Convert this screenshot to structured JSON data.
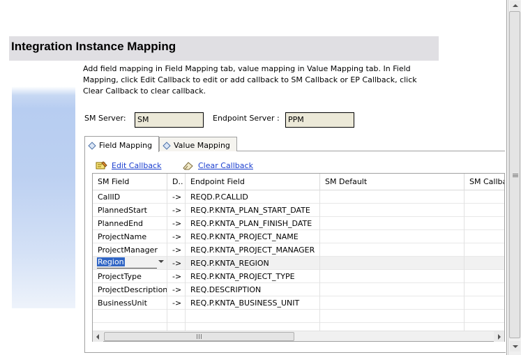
{
  "header": {
    "title": "Integration Instance Mapping"
  },
  "description": "Add field mapping in Field Mapping tab, value mapping in Value Mapping tab. In Field Mapping, click Edit Callback to edit or add callback to SM Callback or EP Callback, click Clear Callback to clear callback.",
  "servers": {
    "sm_label": "SM Server:",
    "sm_value": "SM",
    "ep_label": "Endpoint Server :",
    "ep_value": "PPM"
  },
  "tabs": [
    {
      "label": "Field Mapping",
      "active": true
    },
    {
      "label": "Value Mapping",
      "active": false
    }
  ],
  "actions": {
    "edit_callback": "Edit Callback",
    "clear_callback": "Clear Callback"
  },
  "table": {
    "columns": [
      "SM Field",
      "D..",
      "Endpoint Field",
      "SM Default",
      "SM Callba"
    ],
    "rows": [
      {
        "sm": "CallID",
        "dir": "->",
        "ep": "REQD.P.CALLID"
      },
      {
        "sm": "PlannedStart",
        "dir": "->",
        "ep": "REQ.P.KNTA_PLAN_START_DATE"
      },
      {
        "sm": "PlannedEnd",
        "dir": "->",
        "ep": "REQ.P.KNTA_PLAN_FINISH_DATE"
      },
      {
        "sm": "ProjectName",
        "dir": "->",
        "ep": "REQ.P.KNTA_PROJECT_NAME"
      },
      {
        "sm": "ProjectManager",
        "dir": "->",
        "ep": "REQ.P.KNTA_PROJECT_MANAGER"
      },
      {
        "sm": "Region",
        "dir": "->",
        "ep": "REQ.P.KNTA_REGION",
        "editing": true
      },
      {
        "sm": "ProjectType",
        "dir": "->",
        "ep": "REQ.P.KNTA_PROJECT_TYPE"
      },
      {
        "sm": "ProjectDescription",
        "dir": "->",
        "ep": "REQ.DESCRIPTION"
      },
      {
        "sm": "BusinessUnit",
        "dir": "->",
        "ep": "REQ.P.KNTA_BUSINESS_UNIT"
      }
    ]
  },
  "colors": {
    "link": "#1a3ecf",
    "selection": "#3166c5",
    "title_bg": "#e0dfe3",
    "field_bg": "#ece9d8"
  }
}
